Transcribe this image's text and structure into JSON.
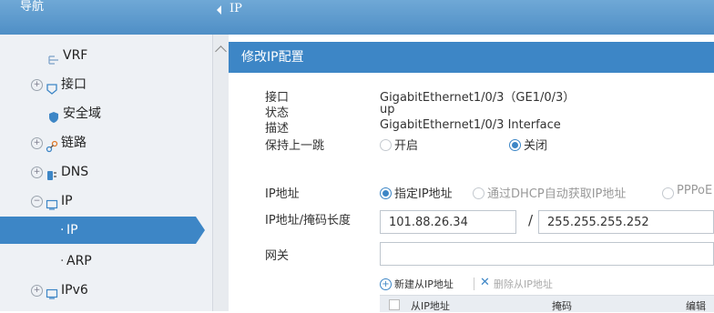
{
  "sidebar": {
    "header": "导航",
    "items": [
      {
        "label": "VRF"
      },
      {
        "label": "接口"
      },
      {
        "label": "安全域"
      },
      {
        "label": "链路"
      },
      {
        "label": "DNS"
      },
      {
        "label": "IP"
      },
      {
        "label": "IP"
      },
      {
        "label": "ARP"
      },
      {
        "label": "IPv6"
      }
    ]
  },
  "topbar": {
    "title": "IP"
  },
  "panel": {
    "title": "修改IP配置",
    "fields": {
      "interface_label": "接口",
      "interface_value": "GigabitEthernet1/0/3（GE1/0/3）",
      "status_label": "状态",
      "status_value": "up",
      "desc_label": "描述",
      "desc_value": "GigabitEthernet1/0/3 Interface",
      "keep_label": "保持上一跳",
      "keep_on": "开启",
      "keep_off": "关闭",
      "ip_label": "IP地址",
      "ip_opt_static": "指定IP地址",
      "ip_opt_dhcp": "通过DHCP自动获取IP地址",
      "ip_opt_pppoe": "PPPoE",
      "ipmask_label": "IP地址/掩码长度",
      "ip_value": "101.88.26.34",
      "slash": "/",
      "mask_value": "255.255.255.252",
      "gateway_label": "网关",
      "gateway_value": ""
    },
    "toolbar": {
      "add": "新建从IP地址",
      "delete": "删除从IP地址"
    },
    "table": {
      "columns": [
        "从IP地址",
        "掩码",
        "编辑"
      ]
    }
  },
  "colors": {
    "accent": "#3d86c6",
    "header": "#5b99cd",
    "sidebar_bg": "#eef1f5"
  }
}
